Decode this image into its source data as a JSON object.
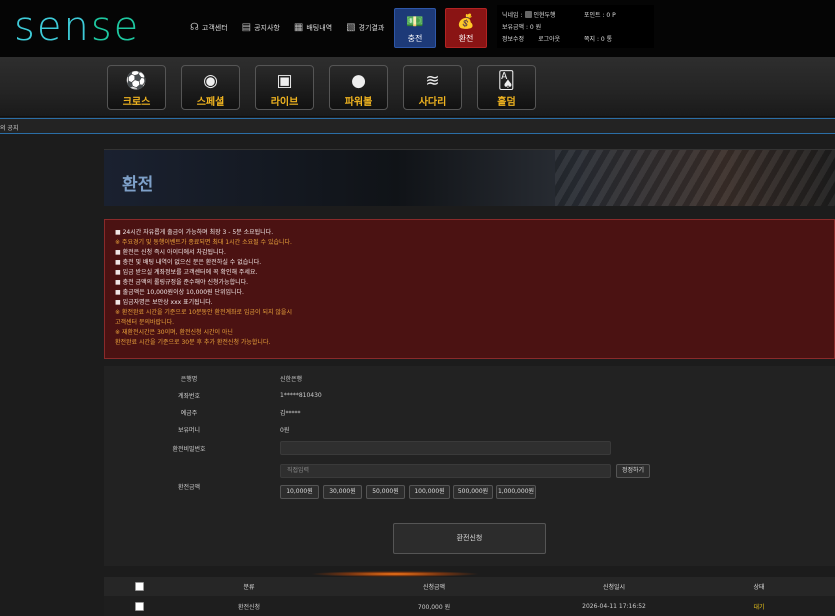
{
  "header": {
    "logo": {
      "main": "sen",
      "accent": "se"
    },
    "nav": [
      {
        "icon": "headset-icon",
        "label": "고객센터"
      },
      {
        "icon": "notice-icon",
        "label": "공지사항"
      },
      {
        "icon": "bet-history-icon",
        "label": "배팅내역"
      },
      {
        "icon": "results-icon",
        "label": "경기결과"
      }
    ],
    "charge_label": "충전",
    "exchange_label": "환전",
    "user": {
      "nickname_label": "닉네임 :",
      "nickname": "인현두행",
      "points": "포인트 : 0 P",
      "balance": "보유금액 : 0 원",
      "message": "쪽지 : 0 통",
      "edit_info": "정보수정",
      "logout": "로그아웃"
    }
  },
  "games": [
    {
      "icon": "cross-icon",
      "label": "크로스"
    },
    {
      "icon": "special-icon",
      "label": "스페셜"
    },
    {
      "icon": "live-icon",
      "label": "라이브"
    },
    {
      "icon": "powerball-icon",
      "label": "파워볼"
    },
    {
      "icon": "ladder-icon",
      "label": "사다리"
    },
    {
      "icon": "holdem-icon",
      "label": "홀덤"
    }
  ],
  "notice_text": "의 공지",
  "page_title": "환전",
  "rules": [
    {
      "text": "■ 24시간 자유롭게 출금이 가능하며 최장 3 - 5분 소요됩니다.",
      "tone": "w"
    },
    {
      "text": "※ 주요경기 및 동행이벤트가 종료되면 최대 1시간 소요될 수 있습니다.",
      "tone": "o"
    },
    {
      "text": "■ 환전은 신청 즉시 아이디에서 차감됩니다.",
      "tone": "w"
    },
    {
      "text": "■ 충전 및 배팅 내역이 없으신 분은 환전하실 수 없습니다.",
      "tone": "w"
    },
    {
      "text": "■ 입금 받으실 계좌정보를 고객센터에 꼭 확인해 주세요.",
      "tone": "w"
    },
    {
      "text": "■ 충전 금액의 롤링규정을 준수해야 신청가능합니다.",
      "tone": "w"
    },
    {
      "text": "■ 출금액은 10,000원이상 10,000원 단위입니다.",
      "tone": "w"
    },
    {
      "text": "■ 입금자명은 보안상 xxx 표기됩니다.",
      "tone": "w"
    },
    {
      "text": "※ 환전완료 시간을 기준으로 10분동안 환전계좌로 입금이 되지 않을시",
      "tone": "o"
    },
    {
      "text": "   고객센터 문의바랍니다.",
      "tone": "o"
    },
    {
      "text": "※ 재환전시간은 30이며, 환전신청 시간이 아닌",
      "tone": "o"
    },
    {
      "text": "   환전완료 시간을 기준으로 30분 후 추가 환전신청 가능합니다.",
      "tone": "o"
    }
  ],
  "form": {
    "bank_label": "은행명",
    "bank_value": "신한은행",
    "account_label": "계좌번호",
    "account_value": "1*****810430",
    "holder_label": "예금주",
    "holder_value": "김*****",
    "money_label": "보유머니",
    "money_value": "0원",
    "pw_label": "환전비밀번호",
    "pw_placeholder": "",
    "amount_label": "환전금액",
    "amount_placeholder": "직접입력",
    "reset_label": "정정하기",
    "quick": [
      "10,000원",
      "30,000원",
      "50,000원",
      "100,000원",
      "500,000원",
      "1,000,000원"
    ],
    "submit_label": "환전신청"
  },
  "table": {
    "headers": [
      "분류",
      "신청금액",
      "신청일시",
      "상태"
    ],
    "rows": [
      {
        "type": "환전신청",
        "amount": "700,000 원",
        "date": "2026-04-11 17:16:52",
        "status": "대기"
      }
    ]
  }
}
